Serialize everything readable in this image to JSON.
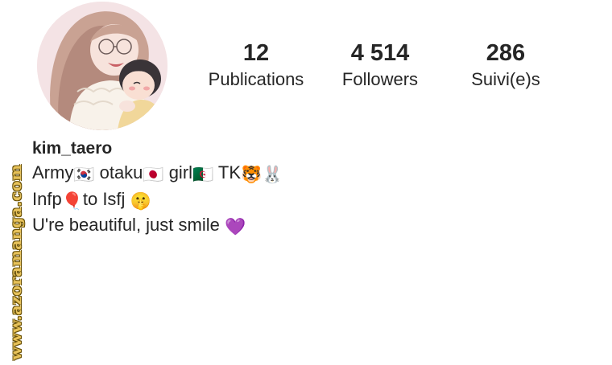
{
  "profile": {
    "username": "kim_taero",
    "avatar_icon": "profile-avatar-illustration"
  },
  "stats": {
    "posts": {
      "value": "12",
      "label": "Publications"
    },
    "followers": {
      "value": "4 514",
      "label": "Followers"
    },
    "following": {
      "value": "286",
      "label": "Suivi(e)s"
    }
  },
  "bio": {
    "line1": [
      {
        "text": "Army"
      },
      {
        "emoji": "🇰🇷",
        "icon": "south-korea-flag-icon"
      },
      {
        "text": " otaku"
      },
      {
        "emoji": "🇯🇵",
        "icon": "japan-flag-icon"
      },
      {
        "text": " girl"
      },
      {
        "emoji": "🇩🇿",
        "icon": "algeria-flag-icon"
      },
      {
        "text": " TK"
      },
      {
        "emoji": "🐯",
        "icon": "tiger-face-icon"
      },
      {
        "emoji": "🐰",
        "icon": "rabbit-face-icon"
      }
    ],
    "line2": [
      {
        "text": "Infp"
      },
      {
        "emoji": "🎈",
        "icon": "balloon-icon"
      },
      {
        "text": "to Isfj "
      },
      {
        "emoji": "🤫",
        "icon": "shushing-face-icon"
      }
    ],
    "line3": [
      {
        "text": "U're beautiful, just smile "
      },
      {
        "emoji": "💜",
        "icon": "purple-heart-icon"
      }
    ]
  },
  "watermark": {
    "text": "www.azoramanga.com",
    "color": "#e7c25a"
  },
  "colors": {
    "text": "#262626",
    "background": "#ffffff"
  }
}
